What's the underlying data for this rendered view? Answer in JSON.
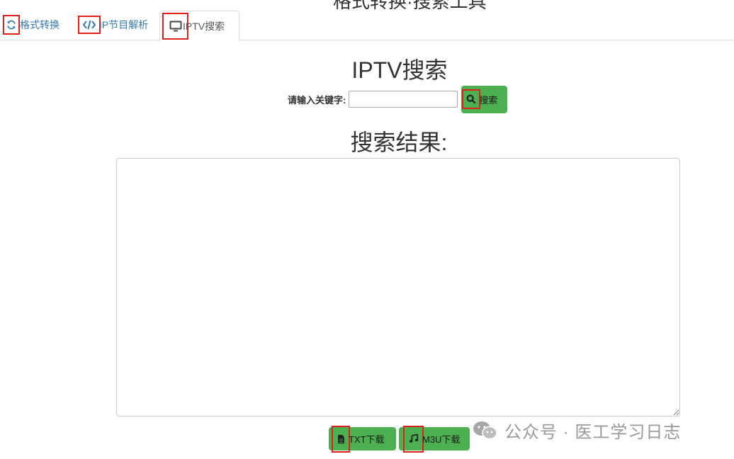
{
  "header": {
    "partial_title": "格式转换·搜索工具"
  },
  "tabs": [
    {
      "label": "格式转换",
      "icon": "refresh-icon"
    },
    {
      "label": "IP节目解析",
      "icon": "code-icon"
    },
    {
      "label": "IPTV搜索",
      "icon": "monitor-icon",
      "active": true
    }
  ],
  "main": {
    "title": "IPTV搜索",
    "search_label": "请输入关键字:",
    "search_value": "",
    "search_button": "搜索",
    "results_title": "搜索结果:",
    "results_text": ""
  },
  "downloads": {
    "txt_label": "TXT下载",
    "m3u_label": "M3U下载"
  },
  "watermark": {
    "text": "公众号 · 医工学习日志"
  },
  "colors": {
    "accent_green": "#4caf50",
    "link_blue": "#337ab7",
    "highlight_red": "#e0201b"
  }
}
